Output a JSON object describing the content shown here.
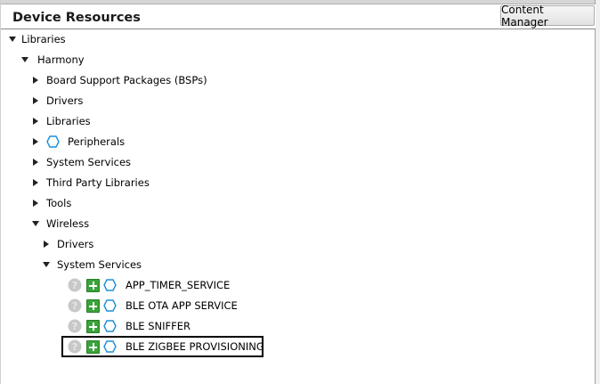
{
  "panel": {
    "title": "Device Resources",
    "content_manager_label": "Content Manager"
  },
  "tree": {
    "libraries": "Libraries",
    "harmony": "Harmony",
    "bsps": "Board Support Packages (BSPs)",
    "drivers": "Drivers",
    "libraries_sub": "Libraries",
    "peripherals": "Peripherals",
    "system_services": "System Services",
    "third_party": "Third Party Libraries",
    "tools": "Tools",
    "wireless": "Wireless",
    "wireless_drivers": "Drivers",
    "wireless_system_services": "System Services"
  },
  "components": [
    {
      "label": "APP_TIMER_SERVICE"
    },
    {
      "label": "BLE OTA APP SERVICE"
    },
    {
      "label": "BLE SNIFFER"
    },
    {
      "label": "BLE ZIGBEE PROVISIONING"
    }
  ],
  "colors": {
    "add_green": "#3aa33a",
    "hex_blue": "#1b8fd8",
    "info_gray": "#c8c8c8"
  }
}
